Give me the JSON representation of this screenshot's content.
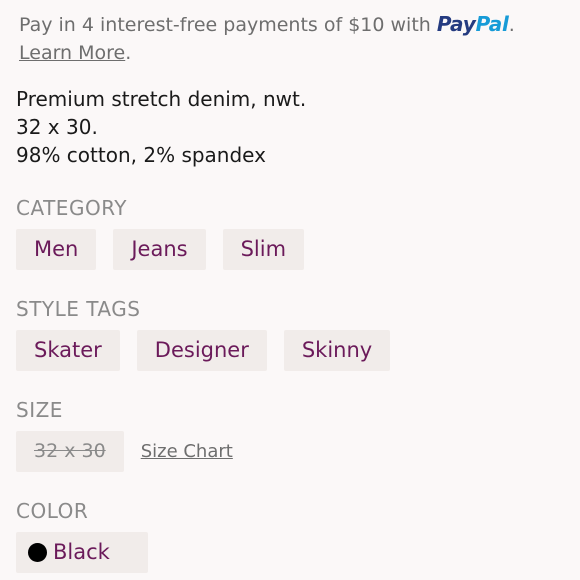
{
  "payment": {
    "text": "Pay in 4 interest-free payments of $10 with ",
    "brand_pay": "Pay",
    "brand_pal": "Pal",
    "period": ".",
    "learn_more": "Learn More",
    "learn_more_period": "."
  },
  "description": {
    "line1": "Premium stretch denim, nwt.",
    "line2": "32 x 30.",
    "line3": "98% cotton, 2% spandex"
  },
  "category": {
    "label": "CATEGORY",
    "items": [
      "Men",
      "Jeans",
      "Slim"
    ]
  },
  "style_tags": {
    "label": "STYLE TAGS",
    "items": [
      "Skater",
      "Designer",
      "Skinny"
    ]
  },
  "size": {
    "label": "SIZE",
    "value": "32 x 30",
    "chart_link": "Size Chart"
  },
  "color": {
    "label": "COLOR",
    "value": "Black",
    "swatch": "#000000"
  }
}
